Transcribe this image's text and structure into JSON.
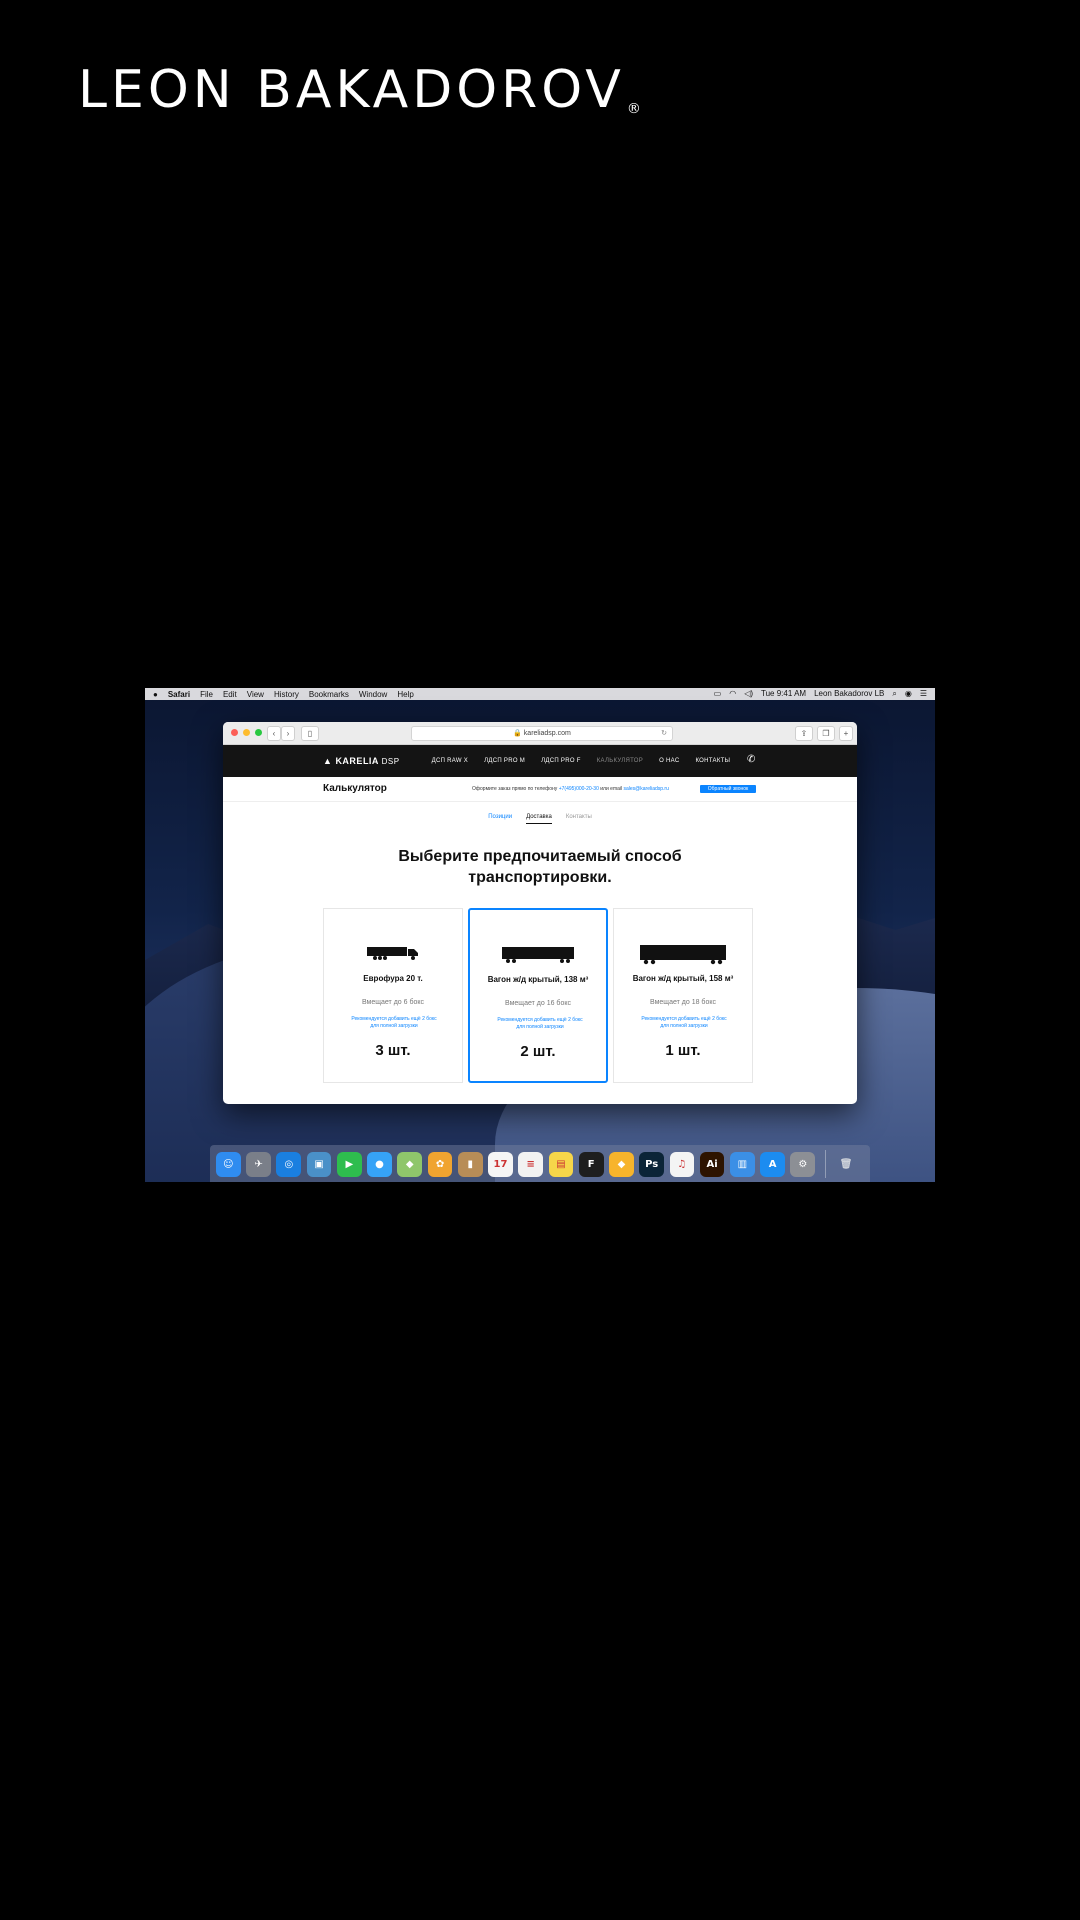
{
  "brand": {
    "name": "LEON BAKADOROV",
    "mark": "®"
  },
  "menubar": {
    "app": "Safari",
    "menus": [
      "File",
      "Edit",
      "View",
      "History",
      "Bookmarks",
      "Window",
      "Help"
    ],
    "clock": "Tue 9:41 AM",
    "user": "Leon Bakadorov LB"
  },
  "browser": {
    "url": "kareliadsp.com"
  },
  "site": {
    "logo": "KARELIA",
    "logo_suffix": "DSP",
    "nav": [
      "ДСП RAW X",
      "ЛДСП PRO M",
      "ЛДСП PRO F",
      "КАЛЬКУЛЯТОР",
      "О НАС",
      "КОНТАКТЫ"
    ],
    "page_title": "Калькулятор",
    "order_text": "Оформите заказ прямо по телефону",
    "order_phone": "+7(495)000-20-30",
    "order_or": "или email",
    "order_email": "sales@kareliadsp.ru",
    "callback_button": "Обратный звонок",
    "tabs": [
      "Позиции",
      "Доставка",
      "Контакты"
    ],
    "heading_line1": "Выберите предпочитаемый способ",
    "heading_line2": "транспортировки.",
    "cards": [
      {
        "name": "Еврофура 20 т.",
        "capacity": "Вмещает до 6 бокс",
        "note_line1": "Рекомендуется добавить ещё 2 бокс",
        "note_line2": "для полной загрузки",
        "qty": "3 шт."
      },
      {
        "name": "Вагон ж/д крытый, 138 м³",
        "capacity": "Вмещает до 16 бокс",
        "note_line1": "Рекомендуется добавить ещё 2 бокс",
        "note_line2": "для полной загрузки",
        "qty": "2 шт."
      },
      {
        "name": "Вагон ж/д крытый, 158 м³",
        "capacity": "Вмещает до 18 бокс",
        "note_line1": "Рекомендуется добавить ещё 2 бокс",
        "note_line2": "для полной загрузки",
        "qty": "1 шт."
      }
    ]
  },
  "dock": {
    "apps": [
      {
        "name": "finder-icon",
        "glyph": "☺",
        "color": "#2f8cf0"
      },
      {
        "name": "launchpad-icon",
        "glyph": "✈",
        "color": "#7a7f89"
      },
      {
        "name": "safari-icon",
        "glyph": "◎",
        "color": "#1a7fe0"
      },
      {
        "name": "preview-icon",
        "glyph": "▣",
        "color": "#4a90c8"
      },
      {
        "name": "facetime-icon",
        "glyph": "▶",
        "color": "#2ebd4e"
      },
      {
        "name": "messages-icon",
        "glyph": "●",
        "color": "#36a3f7"
      },
      {
        "name": "maps-icon",
        "glyph": "◆",
        "color": "#8fc66b"
      },
      {
        "name": "photos-icon",
        "glyph": "✿",
        "color": "#f0a430"
      },
      {
        "name": "contacts-icon",
        "glyph": "▮",
        "color": "#b88d57"
      },
      {
        "name": "calendar-icon",
        "glyph": "17",
        "color": "#f5f5f5"
      },
      {
        "name": "reminders-icon",
        "glyph": "≡",
        "color": "#f2f2f2"
      },
      {
        "name": "notes-icon",
        "glyph": "▤",
        "color": "#f6d64a"
      },
      {
        "name": "figma-icon",
        "glyph": "F",
        "color": "#1e1e1e"
      },
      {
        "name": "sketch-icon",
        "glyph": "◆",
        "color": "#f7b42c"
      },
      {
        "name": "photoshop-icon",
        "glyph": "Ps",
        "color": "#0b2437"
      },
      {
        "name": "itunes-icon",
        "glyph": "♫",
        "color": "#f4f4f4"
      },
      {
        "name": "illustrator-icon",
        "glyph": "Ai",
        "color": "#2d1300"
      },
      {
        "name": "keynote-icon",
        "glyph": "▥",
        "color": "#3b8fe6"
      },
      {
        "name": "app-store-icon",
        "glyph": "A",
        "color": "#1c8cf0"
      },
      {
        "name": "system-preferences-icon",
        "glyph": "⚙",
        "color": "#8c8f95"
      }
    ],
    "trash": {
      "name": "trash-icon",
      "glyph": "🗑",
      "color": "#cfd3da"
    }
  }
}
